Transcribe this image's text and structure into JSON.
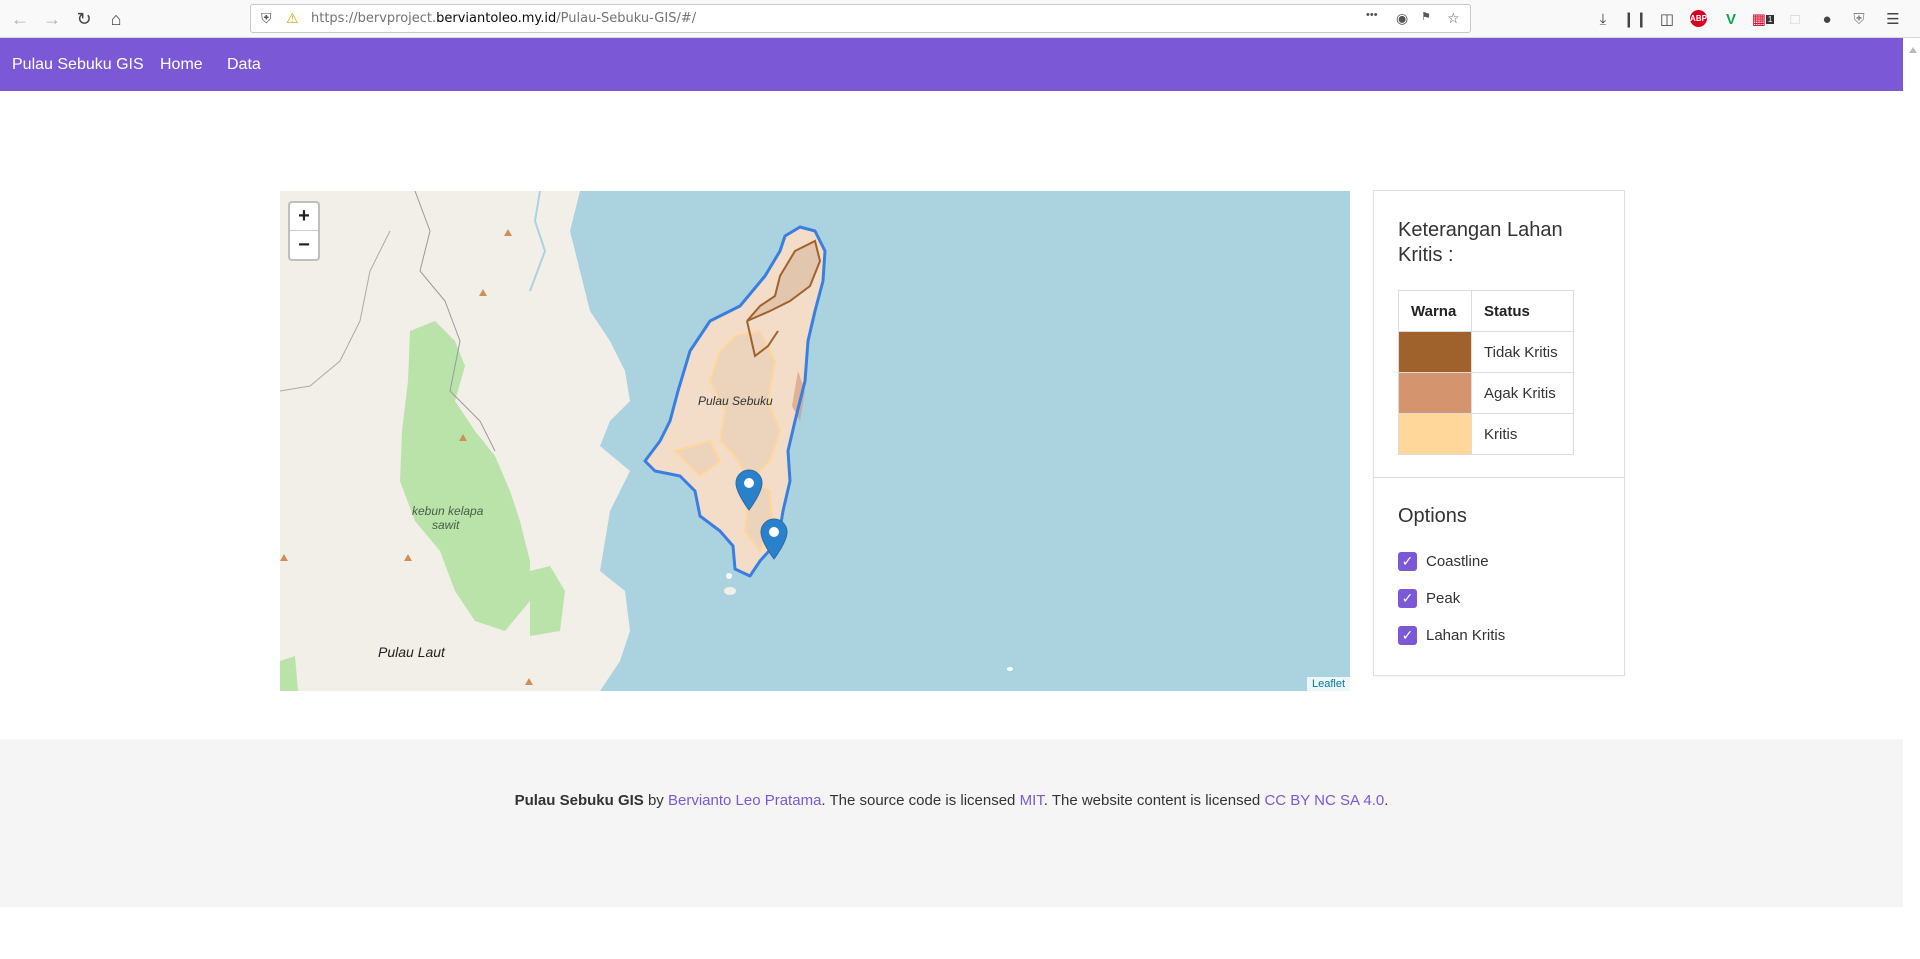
{
  "browser": {
    "url_prefix": "https://bervproject.",
    "url_domain": "berviantoleo.my.id",
    "url_path": "/Pulau-Sebuku-GIS/#/",
    "more_icon": "•••",
    "notification_count": "1"
  },
  "navbar": {
    "brand": "Pulau Sebuku GIS",
    "links": [
      "Home",
      "Data"
    ]
  },
  "map": {
    "zoom_in": "+",
    "zoom_out": "−",
    "attribution": "Leaflet",
    "labels": [
      "Pulau Sebuku",
      "kebun kelapa",
      "sawit",
      "Pulau Laut"
    ],
    "colors": {
      "water": "#aad3df",
      "land": "#f2efe9",
      "park": "#b9e3a9",
      "coastline": "#3a7fe0",
      "tidak_kritis": "#a0622d",
      "agak_kritis": "#d4956e",
      "kritis": "#ffd79a",
      "marker": "#2a81cb"
    }
  },
  "legend": {
    "title": "Keterangan Lahan Kritis :",
    "headers": [
      "Warna",
      "Status"
    ],
    "rows": [
      {
        "color": "#a0622d",
        "status": "Tidak Kritis"
      },
      {
        "color": "#d4956e",
        "status": "Agak Kritis"
      },
      {
        "color": "#ffd79a",
        "status": "Kritis"
      }
    ]
  },
  "options": {
    "title": "Options",
    "items": [
      {
        "label": "Coastline",
        "checked": true
      },
      {
        "label": "Peak",
        "checked": true
      },
      {
        "label": "Lahan Kritis",
        "checked": true
      }
    ]
  },
  "footer": {
    "project": "Pulau Sebuku GIS",
    "by": " by ",
    "author": "Bervianto Leo Pratama",
    "text1": ". The source code is licensed ",
    "license_code": "MIT",
    "text2": ". The website content is licensed ",
    "license_content": "CC BY NC SA 4.0",
    "text3": "."
  }
}
